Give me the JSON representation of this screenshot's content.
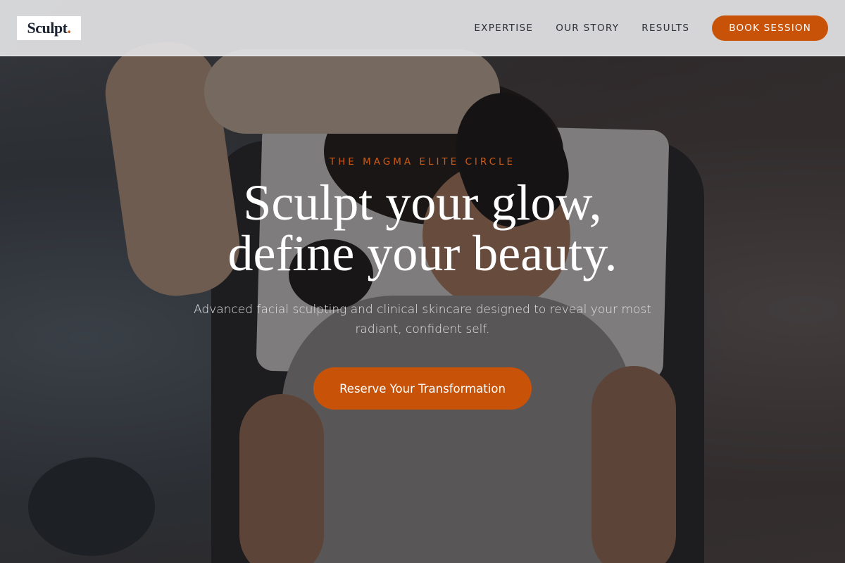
{
  "brand": {
    "logo_text": "Sculpt",
    "logo_dot": ".",
    "accent_color": "#c85308"
  },
  "nav": {
    "items": [
      {
        "label": "EXPERTISE"
      },
      {
        "label": "OUR STORY"
      },
      {
        "label": "RESULTS"
      }
    ],
    "cta_label": "BOOK SESSION"
  },
  "hero": {
    "eyebrow": "THE MAGMA ELITE CIRCLE",
    "headline_line1": "Sculpt your glow,",
    "headline_line2": "define your beauty.",
    "subtext": "Advanced facial sculpting and clinical skincare designed to reveal your most radiant, confident self.",
    "cta_label": "Reserve Your Transformation",
    "background_image": "facial-treatment-photo"
  }
}
